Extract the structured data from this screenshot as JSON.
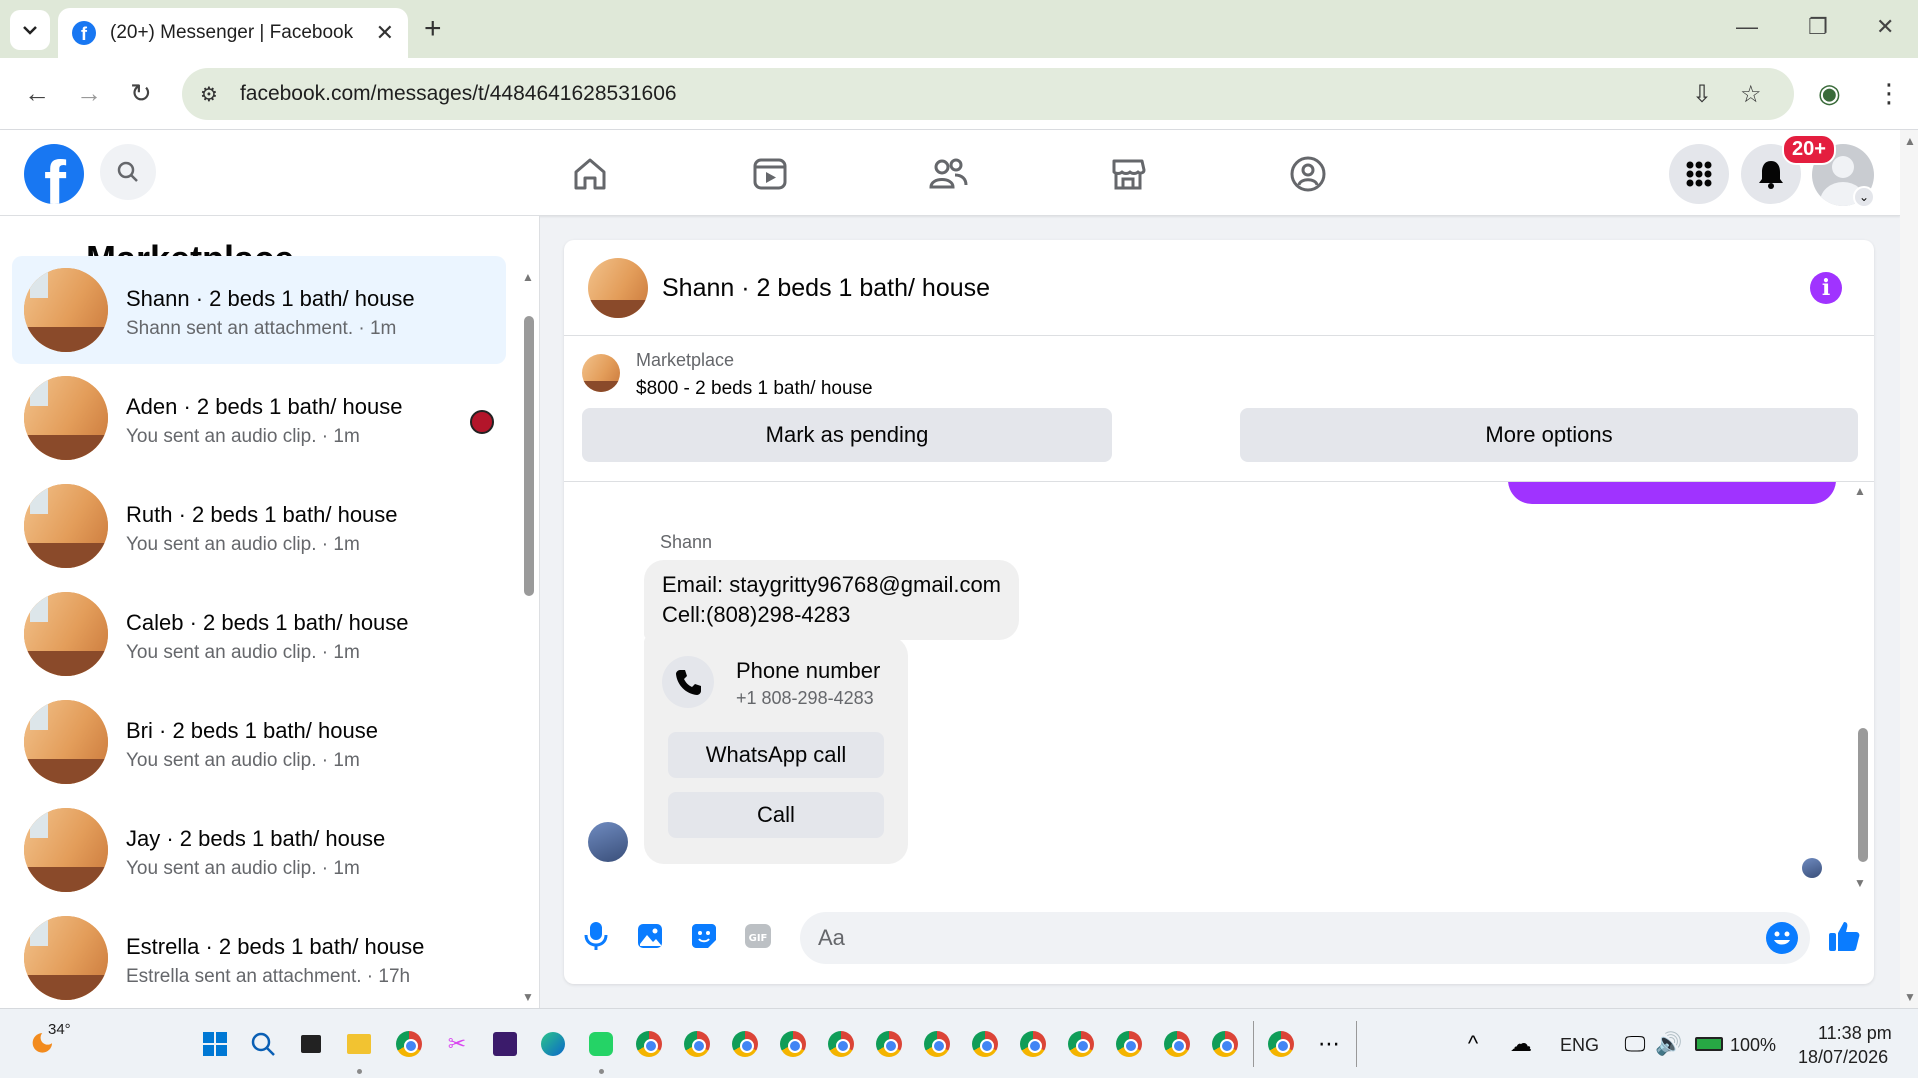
{
  "browser": {
    "tab_title": "(20+) Messenger | Facebook",
    "url": "facebook.com/messages/t/4484641628531606"
  },
  "fb": {
    "notification_badge": "20+"
  },
  "left_panel": {
    "title": "Marketplace",
    "conversations": [
      {
        "name": "Shann · 2 beds 1 bath/ house",
        "sub": "Shann sent an attachment. · 1m",
        "active": true
      },
      {
        "name": "Aden · 2 beds 1 bath/ house",
        "sub": "You sent an audio clip. · 1m"
      },
      {
        "name": "Ruth · 2 beds 1 bath/ house",
        "sub": "You sent an audio clip. · 1m"
      },
      {
        "name": "Caleb · 2 beds 1 bath/ house",
        "sub": "You sent an audio clip. · 1m"
      },
      {
        "name": "Bri · 2 beds 1 bath/ house",
        "sub": "You sent an audio clip. · 1m"
      },
      {
        "name": "Jay · 2 beds 1 bath/ house",
        "sub": "You sent an audio clip. · 1m"
      },
      {
        "name": "Estrella · 2 beds 1 bath/ house",
        "sub": "Estrella sent an attachment. · 17h"
      }
    ]
  },
  "chat": {
    "title": "Shann · 2 beds 1 bath/ house",
    "marketplace_label": "Marketplace",
    "listing": "$800 - 2 beds 1 bath/ house",
    "mark_pending": "Mark as pending",
    "more_options": "More options",
    "sender": "Shann",
    "message_line1": "Email: staygritty96768@gmail.com",
    "message_line2": "Cell:(808)298-4283",
    "phone_card_title": "Phone number",
    "phone_card_number": "+1 808-298-4283",
    "whatsapp_call": "WhatsApp call",
    "call": "Call",
    "composer_placeholder": "Aa"
  },
  "taskbar": {
    "weather": "34°",
    "language": "ENG",
    "battery": "100%",
    "time": "11:38 pm",
    "date": "18/07/2026"
  },
  "colors": {
    "fb_blue": "#1877f2",
    "messenger_purple": "#a033ff",
    "badge_red": "#e41e3f"
  }
}
